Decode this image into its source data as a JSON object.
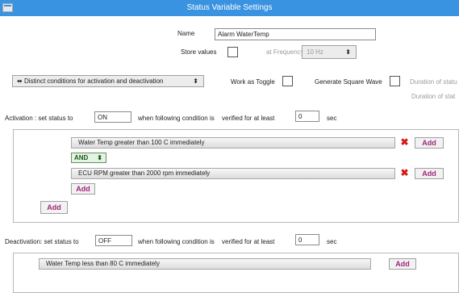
{
  "window": {
    "title": "Status Variable Settings"
  },
  "general": {
    "name_label": "Name",
    "name_value": "Alarm WaterTemp",
    "store_values_label": "Store values",
    "at_frequency_label": "at Frequency",
    "frequency_value": "10 Hz",
    "frequency_arrow": "⬍",
    "mode_select": "Distinct conditions for activation and deactivation",
    "mode_arrow": "⬍",
    "mode_icon": "⬌",
    "work_as_toggle_label": "Work as Toggle",
    "generate_square_wave_label": "Generate Square Wave",
    "duration_label_1": "Duration of statu",
    "duration_label_2": "Duration of stat"
  },
  "activation": {
    "prefix": "Activation : set status to",
    "status_value": "ON",
    "when_text": "when following condition is",
    "verified_text": "verified  for at least",
    "seconds_value": "0",
    "sec_label": "sec",
    "conditions": [
      {
        "text": "Water Temp   greater than   100 C   immediately",
        "add_label": "Add"
      },
      {
        "text": "ECU RPM   greater than   2000 rpm   immediately",
        "add_label": "Add"
      }
    ],
    "logic_operator": "AND",
    "logic_arrow": "⬍",
    "remove_icon": "✖",
    "inner_add_label": "Add",
    "outer_add_label": "Add"
  },
  "deactivation": {
    "prefix": "Deactivation: set status to",
    "status_value": "OFF",
    "when_text": "when following condition is",
    "verified_text": "verified  for at least",
    "seconds_value": "0",
    "sec_label": "sec",
    "conditions": [
      {
        "text": "Water Temp   less than   80 C   immediately",
        "add_label": "Add"
      }
    ]
  }
}
